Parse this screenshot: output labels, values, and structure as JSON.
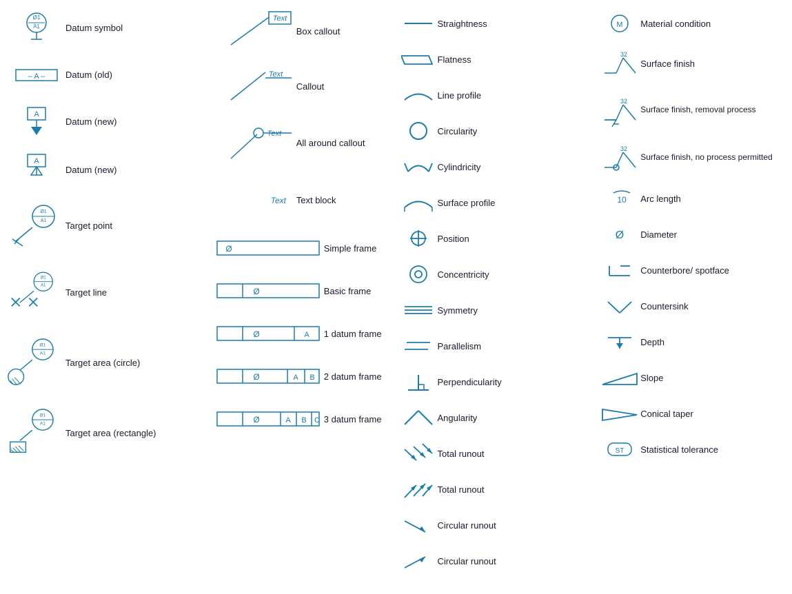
{
  "col1": {
    "items": [
      {
        "id": "datum-symbol",
        "label": "Datum symbol"
      },
      {
        "id": "datum-old",
        "label": "Datum (old)"
      },
      {
        "id": "datum-new1",
        "label": "Datum (new)"
      },
      {
        "id": "datum-new2",
        "label": "Datum (new)"
      },
      {
        "id": "target-point",
        "label": "Target point"
      },
      {
        "id": "target-line",
        "label": "Target line"
      },
      {
        "id": "target-area-circle",
        "label": "Target area (circle)"
      },
      {
        "id": "target-area-rect",
        "label": "Target area (rectangle)"
      }
    ]
  },
  "col2": {
    "callouts": [
      {
        "id": "box-callout",
        "label": "Box callout",
        "text": "Text"
      },
      {
        "id": "callout",
        "label": "Callout",
        "text": "Text"
      },
      {
        "id": "all-around-callout",
        "label": "All around callout",
        "text": "Text"
      },
      {
        "id": "text-block",
        "label": "Text block",
        "text": "Text"
      }
    ],
    "frames": [
      {
        "id": "simple-frame",
        "label": "Simple frame"
      },
      {
        "id": "basic-frame",
        "label": "Basic frame"
      },
      {
        "id": "one-datum-frame",
        "label": "1 datum frame"
      },
      {
        "id": "two-datum-frame",
        "label": "2 datum frame"
      },
      {
        "id": "three-datum-frame",
        "label": "3 datum frame"
      }
    ]
  },
  "col3": {
    "items": [
      {
        "id": "straightness",
        "label": "Straightness"
      },
      {
        "id": "flatness",
        "label": "Flatness"
      },
      {
        "id": "line-profile",
        "label": "Line profile"
      },
      {
        "id": "circularity",
        "label": "Circularity"
      },
      {
        "id": "cylindricity",
        "label": "Cylindricity"
      },
      {
        "id": "surface-profile",
        "label": "Surface profile"
      },
      {
        "id": "position",
        "label": "Position"
      },
      {
        "id": "concentricity",
        "label": "Concentricity"
      },
      {
        "id": "symmetry",
        "label": "Symmetry"
      },
      {
        "id": "parallelism",
        "label": "Parallelism"
      },
      {
        "id": "perpendicularity",
        "label": "Perpendicularity"
      },
      {
        "id": "angularity",
        "label": "Angularity"
      },
      {
        "id": "total-runout1",
        "label": "Total runout"
      },
      {
        "id": "total-runout2",
        "label": "Total runout"
      },
      {
        "id": "circular-runout1",
        "label": "Circular runout"
      },
      {
        "id": "circular-runout2",
        "label": "Circular runout"
      }
    ]
  },
  "col4": {
    "items": [
      {
        "id": "material-condition",
        "label": "Material condition"
      },
      {
        "id": "surface-finish",
        "label": "Surface finish"
      },
      {
        "id": "surface-finish-removal",
        "label": "Surface finish, removal process"
      },
      {
        "id": "surface-finish-no-process",
        "label": "Surface finish, no process permitted"
      },
      {
        "id": "arc-length",
        "label": "Arc length"
      },
      {
        "id": "diameter",
        "label": "Diameter"
      },
      {
        "id": "counterbore",
        "label": "Counterbore/ spotface"
      },
      {
        "id": "countersink",
        "label": "Countersink"
      },
      {
        "id": "depth",
        "label": "Depth"
      },
      {
        "id": "slope",
        "label": "Slope"
      },
      {
        "id": "conical-taper",
        "label": "Conical taper"
      },
      {
        "id": "statistical-tolerance",
        "label": "Statistical tolerance"
      }
    ]
  }
}
